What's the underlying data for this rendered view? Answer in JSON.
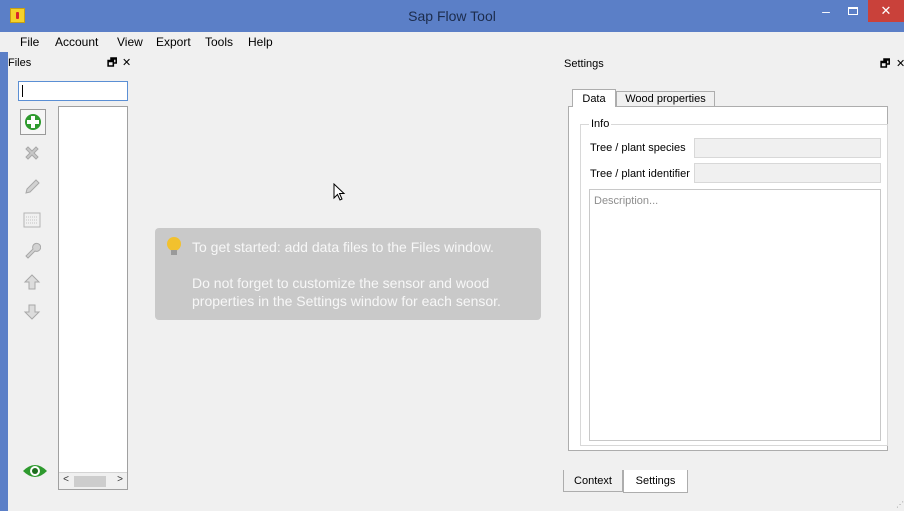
{
  "window": {
    "title": "Sap Flow Tool",
    "controls": {
      "minimize": "–",
      "close": "✕"
    }
  },
  "menu": [
    "File",
    "Account",
    "View",
    "Export",
    "Tools",
    "Help"
  ],
  "files_panel": {
    "title": "Files",
    "float_icon": "🗗",
    "close_icon": "✕",
    "search_value": "",
    "scroll_left": "<",
    "scroll_right": ">",
    "tools": [
      {
        "name": "add-file-icon",
        "enabled": true
      },
      {
        "name": "remove-file-icon",
        "enabled": false
      },
      {
        "name": "edit-pencil-icon",
        "enabled": false
      },
      {
        "name": "data-grid-icon",
        "enabled": false
      },
      {
        "name": "wrench-icon",
        "enabled": false
      },
      {
        "name": "move-up-icon",
        "enabled": false
      },
      {
        "name": "move-down-icon",
        "enabled": false
      }
    ],
    "eye_icon": "eye-icon"
  },
  "hint": {
    "line1": "To get started: add data files to the Files window.",
    "line2": "Do not forget to customize the sensor and wood",
    "line3": "properties in the Settings window for each sensor.",
    "icon": "lightbulb-icon"
  },
  "settings_panel": {
    "title": "Settings",
    "float_icon": "🗗",
    "close_icon": "✕",
    "tabs": [
      "Data",
      "Wood properties"
    ],
    "active_tab": "Data",
    "group_title": "Info",
    "fields": [
      {
        "label": "Tree / plant species",
        "value": ""
      },
      {
        "label": "Tree / plant identifier",
        "value": ""
      }
    ],
    "description_placeholder": "Description..."
  },
  "bottom_tabs": [
    "Context",
    "Settings"
  ],
  "active_bottom_tab": "Settings",
  "colors": {
    "titlebar": "#5b7fc7",
    "close_button": "#c9413a",
    "hint_background": "#c9c9c9",
    "add_icon": "#2e9a2e"
  }
}
